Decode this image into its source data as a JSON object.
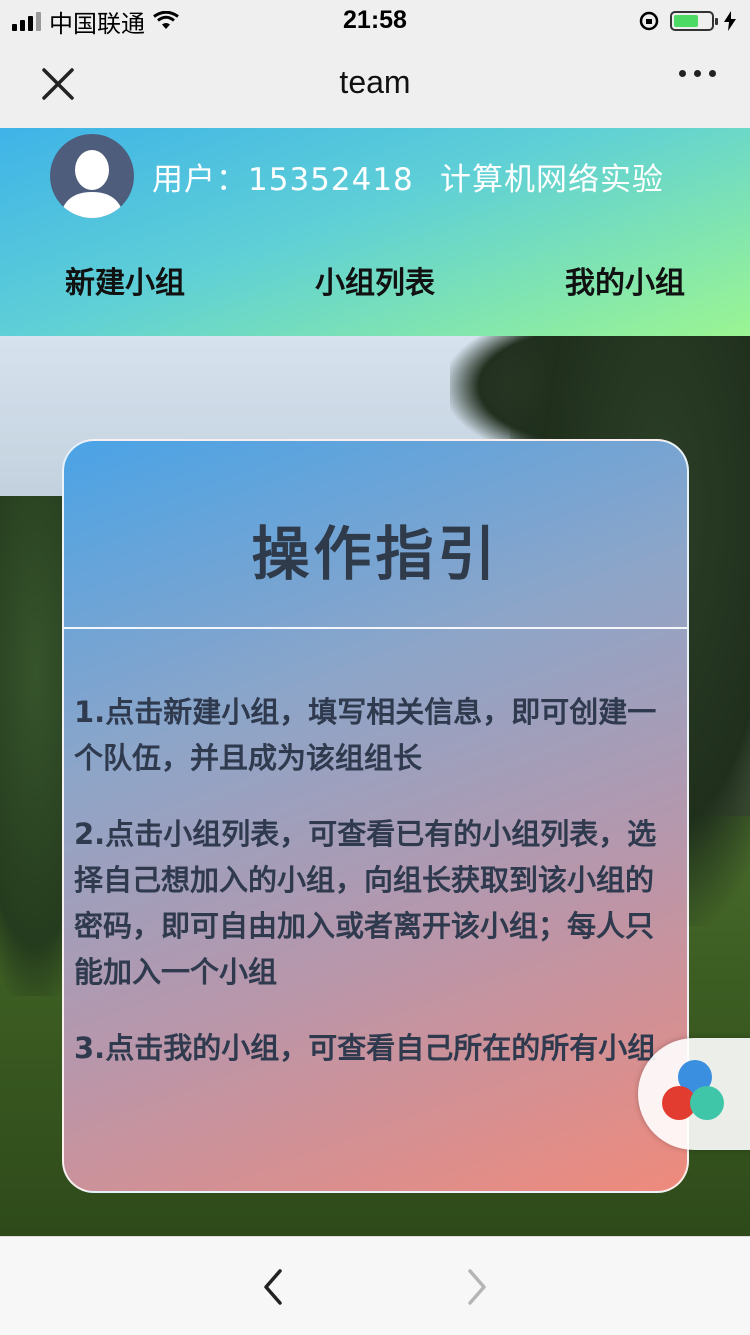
{
  "status_bar": {
    "carrier": "中国联通",
    "time": "21:58"
  },
  "nav": {
    "title": "team"
  },
  "header": {
    "user_label": "用户：15352418",
    "course": "计算机网络实验",
    "tabs": [
      {
        "label": "新建小组"
      },
      {
        "label": "小组列表"
      },
      {
        "label": "我的小组"
      }
    ]
  },
  "guide": {
    "title": "操作指引",
    "steps": [
      "1.点击新建小组，填写相关信息，即可创建一个队伍，并且成为该组组长",
      "2.点击小组列表，可查看已有的小组列表，选择自己想加入的小组，向组长获取到该小组的密码，即可自由加入或者离开该小组；每人只能加入一个小组",
      "3.点击我的小组，可查看自己所在的所有小组"
    ]
  },
  "colors": {
    "header_gradient": [
      "#3fb3e8",
      "#9bf592"
    ],
    "card_gradient": [
      "#4aa3e6",
      "#ef8a7c"
    ],
    "avatar": "#4f5d7c"
  }
}
